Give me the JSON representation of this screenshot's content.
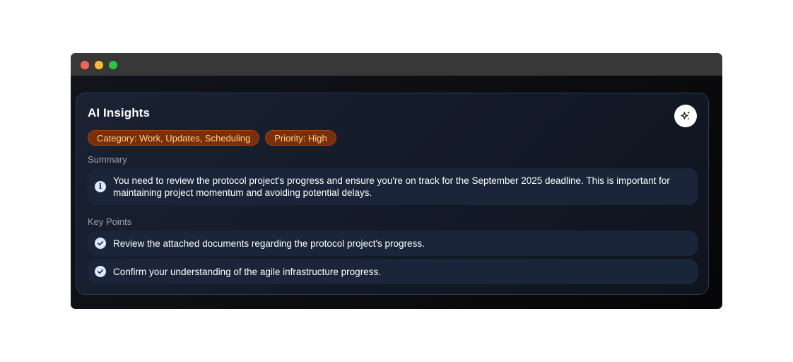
{
  "window": {
    "controls": [
      "close",
      "minimize",
      "maximize"
    ]
  },
  "insights": {
    "title": "AI Insights",
    "action_icon": "sparkles-icon",
    "tags": [
      {
        "label": "Category: Work, Updates, Scheduling"
      },
      {
        "label": "Priority: High"
      }
    ],
    "summary": {
      "label": "Summary",
      "icon": "info-icon",
      "text": "You need to review the protocol project's progress and ensure you're on track for the September 2025 deadline. This is important for maintaining project momentum and avoiding potential delays."
    },
    "key_points": {
      "label": "Key Points",
      "icon": "check-circle-icon",
      "items": [
        {
          "text": "Review the attached documents regarding the protocol project's progress."
        },
        {
          "text": "Confirm your understanding of the agile infrastructure progress."
        }
      ]
    }
  },
  "colors": {
    "tag_bg": "#7a2e09",
    "tag_text": "#fdd592",
    "card_border": "#2b3a55",
    "row_bg": "#1a2539"
  }
}
